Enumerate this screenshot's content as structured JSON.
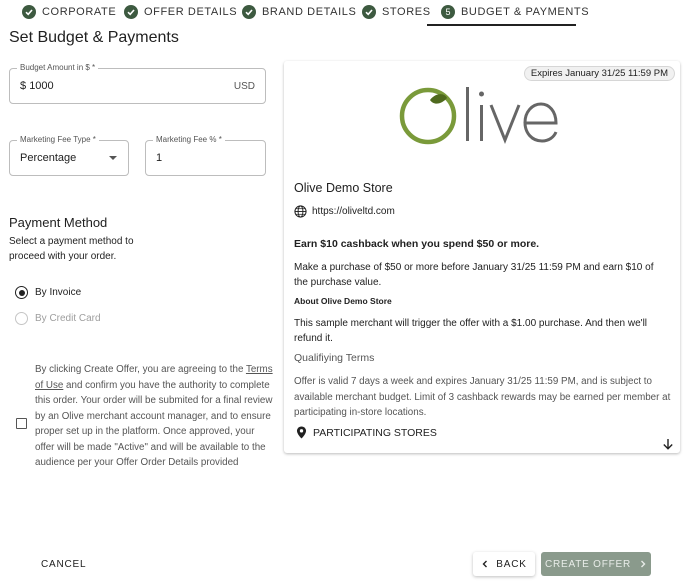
{
  "stepper": {
    "steps": [
      {
        "label": "CORPORATE",
        "state": "done"
      },
      {
        "label": "OFFER DETAILS",
        "state": "done"
      },
      {
        "label": "BRAND DETAILS",
        "state": "done"
      },
      {
        "label": "STORES",
        "state": "done"
      },
      {
        "label": "BUDGET & PAYMENTS",
        "state": "active",
        "number": "5"
      }
    ]
  },
  "page": {
    "title": "Set Budget & Payments"
  },
  "budget": {
    "label": "Budget Amount in $ *",
    "prefix": "$",
    "value": "1000",
    "suffix": "USD"
  },
  "fee_type": {
    "label": "Marketing Fee Type *",
    "value": "Percentage"
  },
  "fee_pct": {
    "label": "Marketing Fee % *",
    "value": "1"
  },
  "payment": {
    "title": "Payment Method",
    "description": "Select a payment method to proceed with your order.",
    "options": [
      {
        "label": "By Invoice",
        "selected": true
      },
      {
        "label": "By Credit Card",
        "selected": false
      }
    ]
  },
  "agreement": {
    "part1": "By clicking Create Offer, you are agreeing to the ",
    "link": "Terms of Use",
    "part2": " and confirm you have the authority to complete this order. Your order will be submited for a final review by an Olive merchant account manager, and to ensure proper set up in the platform. Once approved, your offer will be made \"Active\" and will be available to the audience per your Offer Order Details provided",
    "checked": false
  },
  "card": {
    "expires": "Expires January 31/25 11:59 PM",
    "logo_text": "Olive",
    "store_name": "Olive Demo Store",
    "store_url": "https://oliveltd.com",
    "headline": "Earn $10 cashback when you spend $50 or more.",
    "body": "Make a purchase of $50 or more before January 31/25 11:59 PM and earn $10 of the purchase value.",
    "about_title": "About Olive Demo Store",
    "about_body": "This sample merchant will trigger the offer with a $1.00 purchase. And then we'll refund it.",
    "qual_title": "Qualifiying Terms",
    "qual_body": "Offer is valid 7 days a week and expires January 31/25 11:59 PM, and is subject to available merchant budget. Limit of 3 cashback rewards may be earned per member at participating in-store locations.",
    "participating": "PARTICIPATING STORES"
  },
  "footer": {
    "cancel": "CANCEL",
    "back": "BACK",
    "create": "CREATE OFFER"
  },
  "colors": {
    "step_dot": "#3d5a40",
    "logo_green": "#7a9a3a",
    "logo_grey": "#666666",
    "create_button": "#8a9a8c"
  }
}
